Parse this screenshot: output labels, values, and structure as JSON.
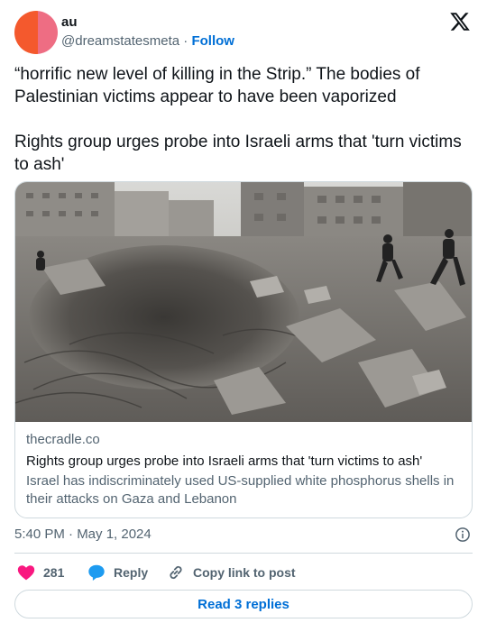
{
  "author": {
    "display_name": "au",
    "handle": "@dreamstatesmeta",
    "separator": " · ",
    "follow_label": "Follow"
  },
  "tweet": {
    "paragraphs": [
      "“horrific new level of killing in the Strip.” The bodies of Palestinian victims appear to have been vaporized",
      "Rights group urges probe into Israeli arms that 'turn victims to ash'"
    ]
  },
  "link_card": {
    "domain": "thecradle.co",
    "title": "Rights group urges probe into Israeli arms that 'turn victims to ash'",
    "description": "Israel has indiscriminately used US-supplied white phosphorus shells in their attacks on Gaza and Lebanon",
    "image_alt": "Rubble and a large crater in Gaza with people climbing over debris"
  },
  "timestamp": "5:40 PM · May 1, 2024",
  "actions": {
    "like_count": "281",
    "reply_label": "Reply",
    "copy_label": "Copy link to post"
  },
  "read_replies_label": "Read 3 replies",
  "icons": {
    "logo": "x-logo-icon",
    "info": "info-icon",
    "like": "heart-icon",
    "reply": "reply-bubble-icon",
    "copy": "link-icon"
  },
  "colors": {
    "accent": "#006fd6",
    "like": "#f91880",
    "reply_icon": "#1d9bf0",
    "muted": "#536471",
    "text": "#0f1419",
    "border": "#cfd9de",
    "avatar_left": "#f4592d",
    "avatar_right": "#ee6d83"
  }
}
